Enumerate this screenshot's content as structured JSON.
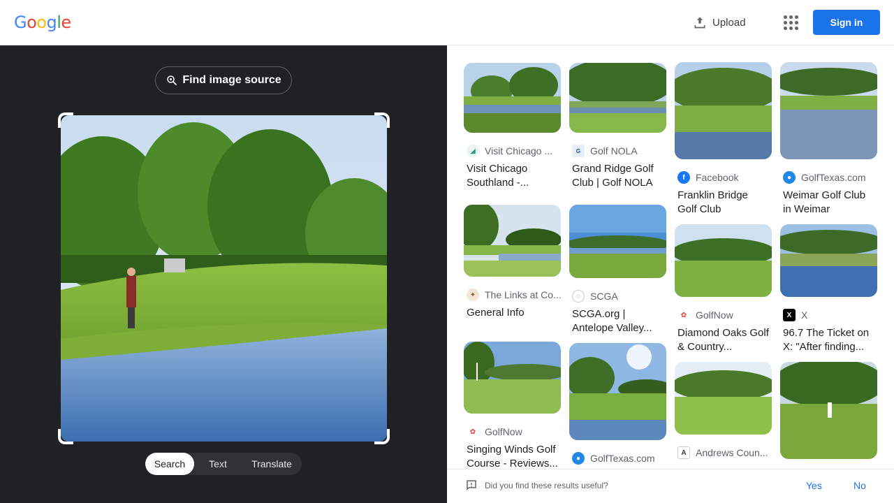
{
  "header": {
    "logo_text": "Google",
    "upload_label": "Upload",
    "signin_label": "Sign in"
  },
  "left": {
    "find_source_label": "Find image source",
    "tabs": [
      {
        "label": "Search",
        "active": true
      },
      {
        "label": "Text",
        "active": false
      },
      {
        "label": "Translate",
        "active": false
      }
    ]
  },
  "results": {
    "columns": [
      [
        {
          "source": "Visit Chicago ...",
          "title": "Visit Chicago Southland -...",
          "icon": "visit-chicago-favicon"
        },
        {
          "source": "The Links at Co...",
          "title": "General Info",
          "icon": "links-favicon"
        },
        {
          "source": "GolfNow",
          "title": "Singing Winds Golf Course - Reviews...",
          "icon": "golfnow-favicon"
        }
      ],
      [
        {
          "source": "Golf NOLA",
          "title": "Grand Ridge Golf Club | Golf NOLA",
          "icon": "golf-nola-favicon"
        },
        {
          "source": "SCGA",
          "title": "SCGA.org | Antelope Valley...",
          "icon": "scga-favicon"
        },
        {
          "source": "GolfTexas.com",
          "title": "",
          "icon": "golftexas-favicon"
        }
      ],
      [
        {
          "source": "Facebook",
          "title": "Franklin Bridge Golf Club",
          "icon": "facebook-favicon"
        },
        {
          "source": "GolfNow",
          "title": "Diamond Oaks Golf & Country...",
          "icon": "golfnow-favicon"
        },
        {
          "source": "Andrews Coun...",
          "title": "",
          "icon": "andrews-favicon"
        }
      ],
      [
        {
          "source": "GolfTexas.com",
          "title": "Weimar Golf Club in Weimar",
          "icon": "golftexas-favicon"
        },
        {
          "source": "X",
          "title": "96.7 The Ticket on X: \"After finding...",
          "icon": "x-favicon"
        },
        {
          "source": "",
          "title": "",
          "icon": ""
        }
      ]
    ]
  },
  "feedback": {
    "question": "Did you find these results useful?",
    "yes_label": "Yes",
    "no_label": "No"
  },
  "colors": {
    "accent": "#1a73e8",
    "panel_dark": "#202124"
  }
}
